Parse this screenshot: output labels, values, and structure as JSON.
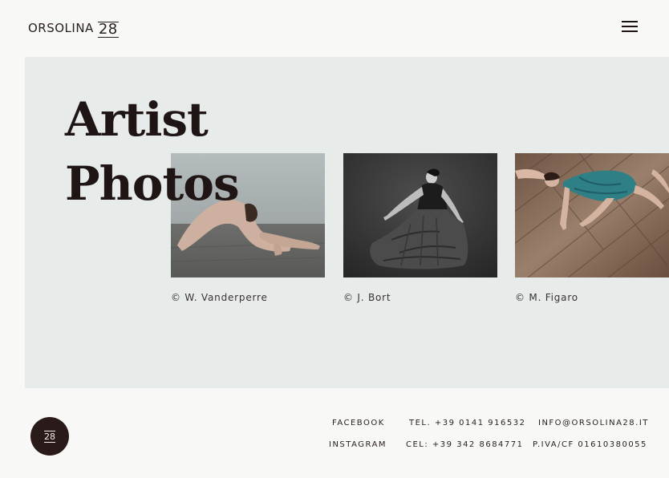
{
  "header": {
    "logo_text": "ORSOLINA",
    "logo_number": "28",
    "menu_icon": "hamburger-menu-icon"
  },
  "main": {
    "title_line1": "Artist",
    "title_line2": "Photos",
    "photos": [
      {
        "credit": "© W. Vanderperre"
      },
      {
        "credit": "© J. Bort"
      },
      {
        "credit": "© M. Figaro"
      }
    ]
  },
  "footer": {
    "badge_number": "28",
    "facebook": "FACEBOOK",
    "instagram": "INSTAGRAM",
    "tel": "TEL. +39 0141 916532",
    "cel": "CEL: +39 342 8684771",
    "email": "INFO@ORSOLINA28.IT",
    "vat": "P.IVA/CF 01610380055"
  },
  "colors": {
    "page_background": "#f8f8f7",
    "panel_background": "#e7ecea",
    "text_dark": "#1f1515",
    "badge_background": "#2a1a1a"
  }
}
